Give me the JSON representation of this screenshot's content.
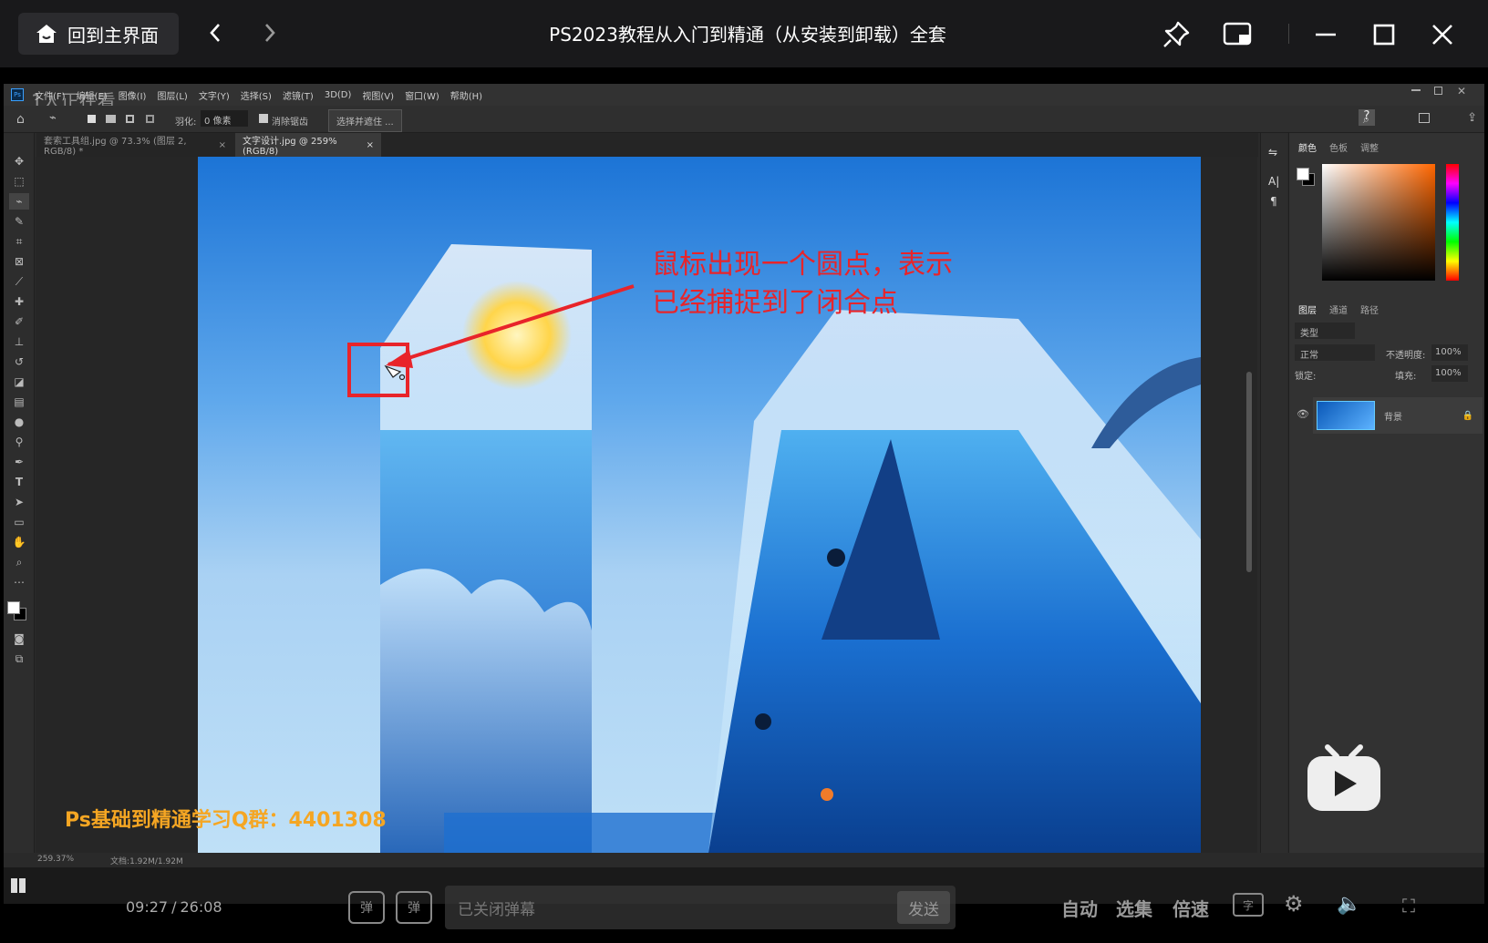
{
  "player": {
    "home_label": "回到主界面",
    "title": "PS2023教程从入门到精通（从安装到卸载）全套"
  },
  "ps": {
    "menu": [
      "文件(F)",
      "编辑(E)",
      "图像(I)",
      "图层(L)",
      "文字(Y)",
      "选择(S)",
      "滤镜(T)",
      "3D(D)",
      "视图(V)",
      "窗口(W)",
      "帮助(H)"
    ],
    "watching": "1人正在看",
    "options": {
      "feather_label": "羽化:",
      "feather_value": "0 像素",
      "antialias_label": "消除锯齿",
      "select_mask_button": "选择并遮住 ..."
    },
    "tabs": [
      {
        "label": "套索工具组.jpg @ 73.3% (图层 2, RGB/8) *"
      },
      {
        "label": "文字设计.jpg @ 259%(RGB/8)"
      }
    ],
    "color_panel_tabs": [
      "颜色",
      "色板",
      "调整"
    ],
    "layers_panel_tabs": [
      "图层",
      "通道",
      "路径"
    ],
    "layer_filter": "类型",
    "blend_mode": "正常",
    "opacity_label": "不透明度:",
    "opacity_value": "100%",
    "lock_label": "锁定:",
    "fill_label": "填充:",
    "fill_value": "100%",
    "layer_name": "背景",
    "status_zoom": "259.37%",
    "status_doc": "文档:1.92M/1.92M"
  },
  "annotation": {
    "line1": "鼠标出现一个圆点，表示",
    "line2": "已经捕捉到了闭合点"
  },
  "watermark": {
    "qgroup": "Ps基础到精通学习Q群：4401308"
  },
  "controls": {
    "time_current": "09:27",
    "time_sep": "/",
    "time_total": "26:08",
    "danmu_placeholder": "已关闭弹幕",
    "send_label": "发送",
    "auto_label": "自动",
    "episodes_label": "选集",
    "speed_label": "倍速"
  },
  "colors": {
    "annotation_red": "#e8242a",
    "accent_orange": "#f5a623"
  }
}
